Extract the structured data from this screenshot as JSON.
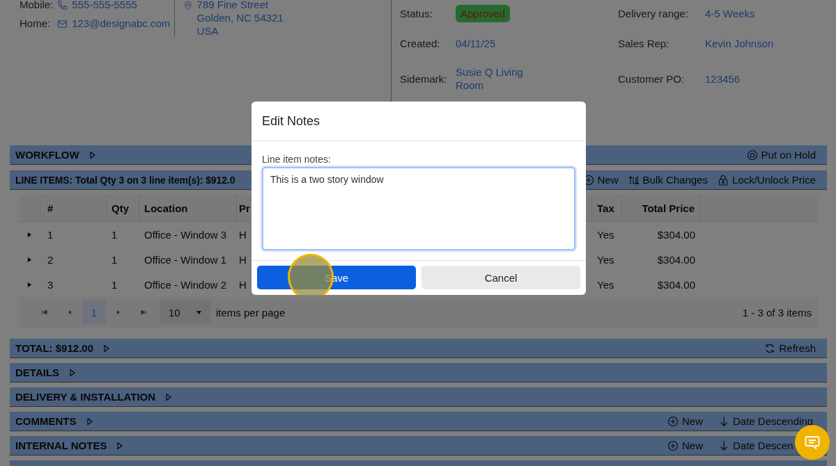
{
  "contact": {
    "mobile_label": "Mobile:",
    "mobile": "555-555-5555",
    "home_label": "Home:",
    "home": "123@designabc.com",
    "address": [
      "789 Fine Street",
      "Golden, NC 54321",
      "USA"
    ]
  },
  "order_info_left": [
    {
      "label": "Status:",
      "value": "Approved",
      "kind": "badge"
    },
    {
      "label": "Created:",
      "value": "04/11/25",
      "kind": "link"
    },
    {
      "label": "Sidemark:",
      "value": "Susie Q Living Room",
      "kind": "link"
    }
  ],
  "order_info_right": [
    {
      "label": "Delivery range:",
      "value": "4-5 Weeks",
      "kind": "link"
    },
    {
      "label": "Sales Rep:",
      "value": "Kevin Johnson",
      "kind": "link"
    },
    {
      "label": "Customer PO:",
      "value": "123456",
      "kind": "link"
    }
  ],
  "workflow": {
    "title": "WORKFLOW",
    "actions": [
      {
        "label": "Put on Hold",
        "kind": "hold"
      }
    ]
  },
  "line_items": {
    "title": "LINE ITEMS: Total Qty 3 on 3 line item(s): $912.0",
    "actions": [
      {
        "label": "New",
        "kind": "new"
      },
      {
        "label": "Bulk Changes",
        "kind": "bulk"
      },
      {
        "label": "Lock/Unlock Price",
        "kind": "lock"
      }
    ],
    "table": {
      "columns": [
        "#",
        "Qty",
        "Location",
        "Pr",
        "Tax",
        "Total Price"
      ],
      "rows": [
        {
          "cells": [
            "1",
            "1",
            "Office - Window 3",
            "H",
            "Yes",
            "$304.00"
          ]
        },
        {
          "cells": [
            "2",
            "1",
            "Office - Window 1",
            "H",
            "Yes",
            "$304.00"
          ]
        },
        {
          "cells": [
            "3",
            "1",
            "Office - Window 2",
            "H",
            "Yes",
            "$304.00"
          ]
        }
      ]
    },
    "pager": {
      "pages": [
        {
          "label": "1",
          "selected": true
        }
      ],
      "page_size": "10",
      "per_page_label": "items per page",
      "summary": "1 - 3 of 3 items"
    }
  },
  "sections": [
    {
      "title": "TOTAL: $912.00",
      "actions": [
        {
          "label": "Refresh",
          "kind": "refresh"
        }
      ]
    },
    {
      "title": "DETAILS"
    },
    {
      "title": "DELIVERY & INSTALLATION"
    },
    {
      "title": "COMMENTS",
      "actions": [
        {
          "label": "New",
          "kind": "new"
        },
        {
          "label": "Date Descending",
          "kind": "sort"
        }
      ]
    },
    {
      "title": "INTERNAL NOTES",
      "actions": [
        {
          "label": "New",
          "kind": "new"
        },
        {
          "label": "Date Descen",
          "kind": "sort"
        }
      ]
    }
  ],
  "modal": {
    "title": "Edit Notes",
    "field_label": "Line item notes:",
    "value": "This is a two story window",
    "buttons": [
      {
        "label": "Save",
        "kind": "primary"
      },
      {
        "label": "Cancel",
        "kind": "secondary"
      }
    ]
  }
}
